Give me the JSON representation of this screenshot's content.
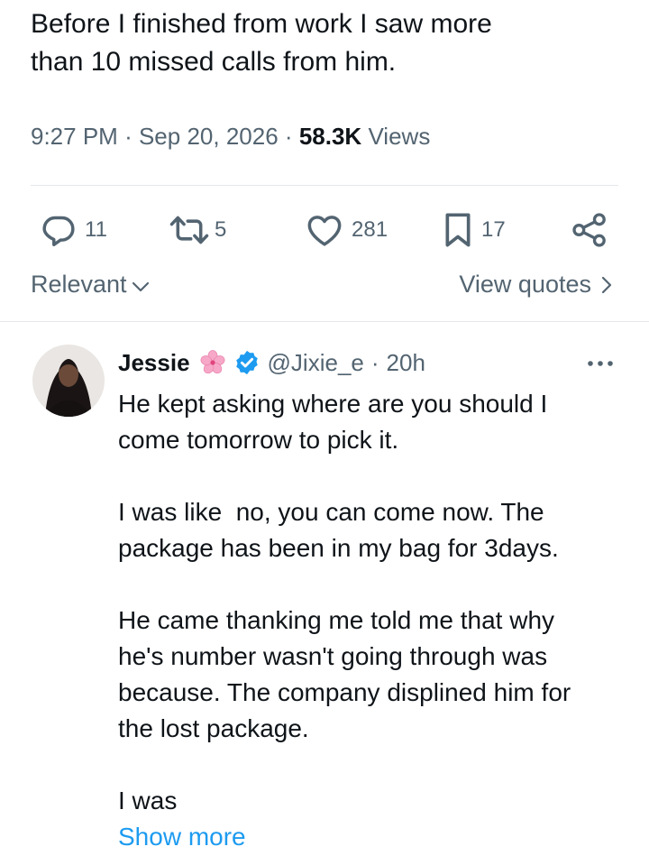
{
  "tweet": {
    "text_lines": [
      "Before I finished from work I saw more",
      "than 10 missed calls from him."
    ],
    "time": "9:27 PM",
    "date": "Sep 20, 2026",
    "views_count": "58.3K",
    "views_label": "Views",
    "separator": "·"
  },
  "actions": {
    "replies": "11",
    "reposts": "5",
    "likes": "281",
    "bookmarks": "17",
    "icons": [
      "reply-icon",
      "repost-icon",
      "like-icon",
      "bookmark-icon",
      "share-icon"
    ]
  },
  "sort": {
    "relevant_label": "Relevant",
    "view_quotes_label": "View quotes"
  },
  "reply": {
    "author_name": "Jessie",
    "handle": "@Jixie_e",
    "separator": "·",
    "time": "20h",
    "paragraphs": [
      [
        "He kept asking where are you should I",
        "come tomorrow to pick it."
      ],
      [
        "I was like  no, you can come now. The",
        "package has been in my bag for 3days."
      ],
      [
        "He came thanking me told me that why",
        "he's number wasn't going through was",
        "because. The company displined him for",
        "the lost package."
      ],
      [
        "I was"
      ]
    ],
    "show_more_label": "Show more"
  },
  "colors": {
    "text_primary": "#0f1419",
    "text_secondary": "#536471",
    "accent": "#1d9bf0",
    "divider": "#e4e7ea",
    "flower": "#f7a8c8"
  }
}
